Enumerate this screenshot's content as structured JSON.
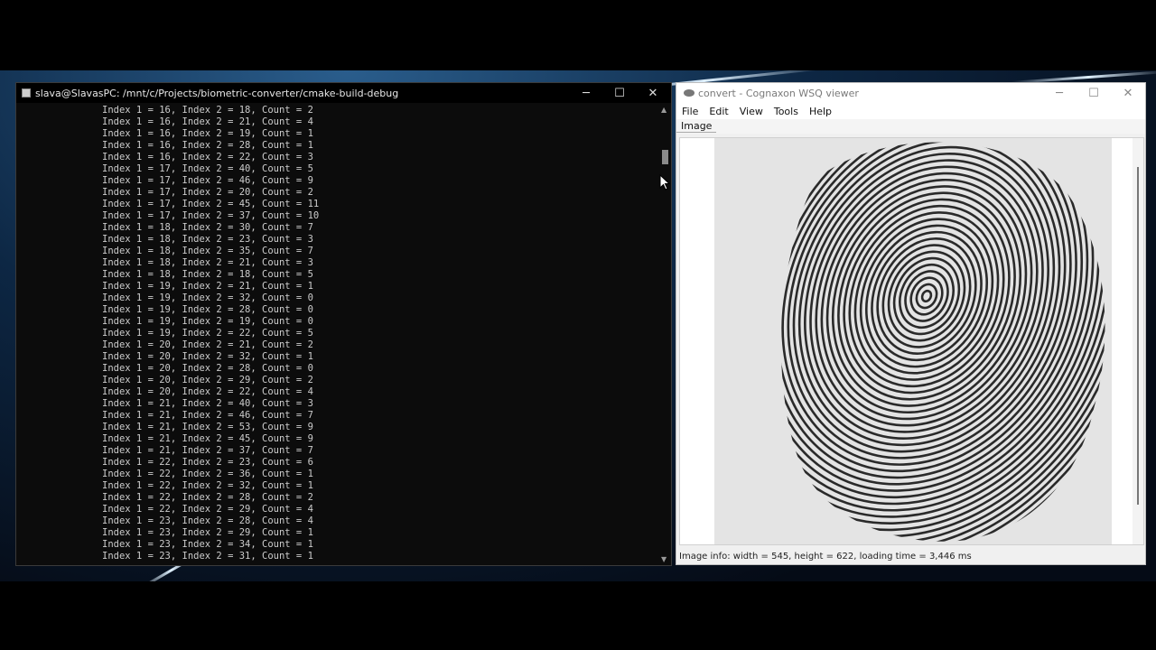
{
  "terminal": {
    "title": "slava@SlavasPC: /mnt/c/Projects/biometric-converter/cmake-build-debug",
    "controls": {
      "minimize": "─",
      "maximize": "☐",
      "close": "✕"
    },
    "lines": [
      "Index 1 = 16, Index 2 = 18, Count = 2",
      "Index 1 = 16, Index 2 = 21, Count = 4",
      "Index 1 = 16, Index 2 = 19, Count = 1",
      "Index 1 = 16, Index 2 = 28, Count = 1",
      "Index 1 = 16, Index 2 = 22, Count = 3",
      "Index 1 = 17, Index 2 = 40, Count = 5",
      "Index 1 = 17, Index 2 = 46, Count = 9",
      "Index 1 = 17, Index 2 = 20, Count = 2",
      "Index 1 = 17, Index 2 = 45, Count = 11",
      "Index 1 = 17, Index 2 = 37, Count = 10",
      "Index 1 = 18, Index 2 = 30, Count = 7",
      "Index 1 = 18, Index 2 = 23, Count = 3",
      "Index 1 = 18, Index 2 = 35, Count = 7",
      "Index 1 = 18, Index 2 = 21, Count = 3",
      "Index 1 = 18, Index 2 = 18, Count = 5",
      "Index 1 = 19, Index 2 = 21, Count = 1",
      "Index 1 = 19, Index 2 = 32, Count = 0",
      "Index 1 = 19, Index 2 = 28, Count = 0",
      "Index 1 = 19, Index 2 = 19, Count = 0",
      "Index 1 = 19, Index 2 = 22, Count = 5",
      "Index 1 = 20, Index 2 = 21, Count = 2",
      "Index 1 = 20, Index 2 = 32, Count = 1",
      "Index 1 = 20, Index 2 = 28, Count = 0",
      "Index 1 = 20, Index 2 = 29, Count = 2",
      "Index 1 = 20, Index 2 = 22, Count = 4",
      "Index 1 = 21, Index 2 = 40, Count = 3",
      "Index 1 = 21, Index 2 = 46, Count = 7",
      "Index 1 = 21, Index 2 = 53, Count = 9",
      "Index 1 = 21, Index 2 = 45, Count = 9",
      "Index 1 = 21, Index 2 = 37, Count = 7",
      "Index 1 = 22, Index 2 = 23, Count = 6",
      "Index 1 = 22, Index 2 = 36, Count = 1",
      "Index 1 = 22, Index 2 = 32, Count = 1",
      "Index 1 = 22, Index 2 = 28, Count = 2",
      "Index 1 = 22, Index 2 = 29, Count = 4",
      "Index 1 = 23, Index 2 = 28, Count = 4",
      "Index 1 = 23, Index 2 = 29, Count = 1",
      "Index 1 = 23, Index 2 = 34, Count = 1",
      "Index 1 = 23, Index 2 = 31, Count = 1"
    ]
  },
  "viewer": {
    "title": "convert - Cognaxon WSQ viewer",
    "controls": {
      "minimize": "─",
      "maximize": "☐",
      "close": "✕"
    },
    "menu": [
      "File",
      "Edit",
      "View",
      "Tools",
      "Help"
    ],
    "tab": "Image",
    "status": "Image info: width = 545, height = 622, loading time = 3,446 ms"
  }
}
